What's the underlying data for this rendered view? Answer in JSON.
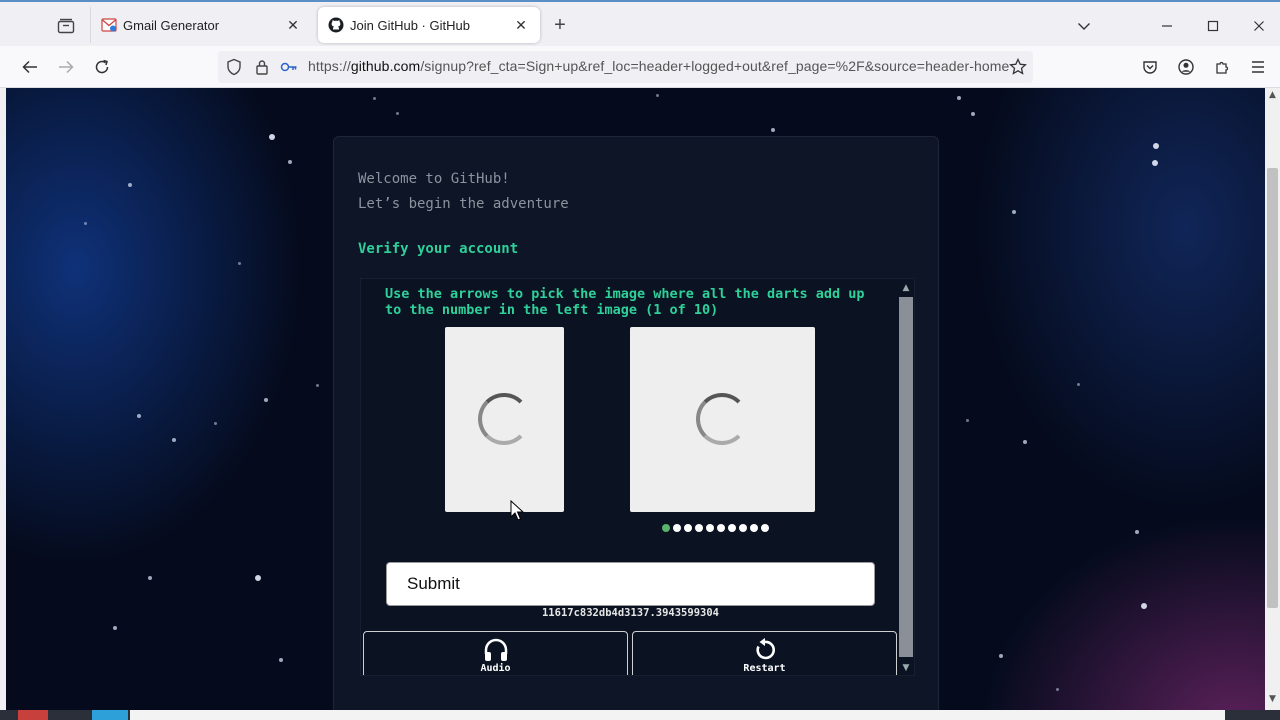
{
  "browser": {
    "tabs": [
      {
        "title": "Gmail Generator",
        "active": false,
        "icon": "gmail-generator-favicon"
      },
      {
        "title": "Join GitHub · GitHub",
        "active": true,
        "icon": "github-favicon"
      }
    ],
    "url": {
      "prefix": "https://",
      "host": "github.com",
      "rest": "/signup?ref_cta=Sign+up&ref_loc=header+logged+out&ref_page=%2F&source=header-home"
    }
  },
  "page": {
    "welcome_line1": "Welcome to GitHub!",
    "welcome_line2": "Let’s begin the adventure",
    "verify_title": "Verify your account",
    "captcha": {
      "instruction": "Use the arrows to pick the image where all the darts add up to the number in the left image (1 of 10)",
      "dots_total": 10,
      "dots_active_index": 0,
      "submit_label": "Submit",
      "session_id": "11617c832db4d3137.3943599304",
      "audio_label": "Audio",
      "restart_label": "Restart"
    }
  },
  "colors": {
    "accent_green": "#2fd09a",
    "page_bg": "#050b1d",
    "active_dot": "#59b36b"
  }
}
